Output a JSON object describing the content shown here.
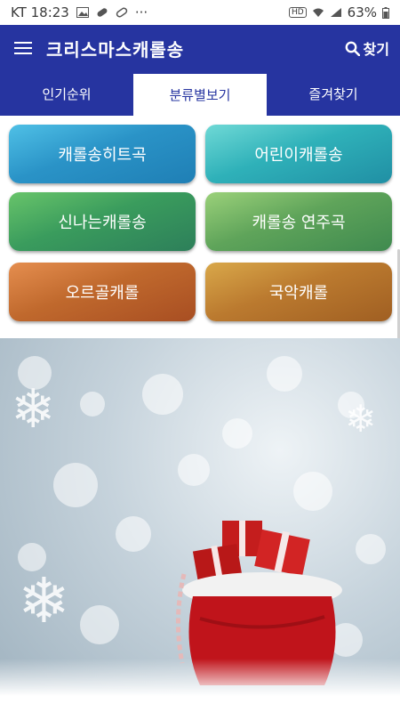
{
  "status_bar": {
    "carrier_time": "KT 18:23",
    "more": "···",
    "hd": "HD",
    "battery": "63%"
  },
  "app_bar": {
    "title": "크리스마스캐롤송",
    "search_label": "찾기"
  },
  "tabs": [
    {
      "label": "인기순위",
      "active": false
    },
    {
      "label": "분류별보기",
      "active": true
    },
    {
      "label": "즐겨찾기",
      "active": false
    }
  ],
  "categories": [
    {
      "label": "캐롤송히트곡"
    },
    {
      "label": "어린이캐롤송"
    },
    {
      "label": "신나는캐롤송"
    },
    {
      "label": "캐롤송 연주곡"
    },
    {
      "label": "오르골캐롤"
    },
    {
      "label": "국악캐롤"
    }
  ],
  "colors": {
    "primary": "#2634a0",
    "white": "#ffffff"
  }
}
